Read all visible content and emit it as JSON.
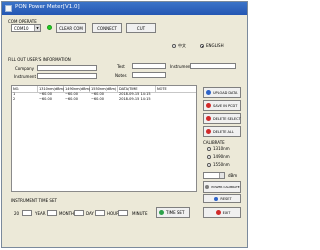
{
  "window": {
    "title": "PON Power Meter[V1.0]"
  },
  "com_operate": {
    "label": "COM OPERATE",
    "port_value": "COM10",
    "clear_com": "CLEAR COM",
    "connect": "CONNECT",
    "cut": "CUT"
  },
  "language": {
    "chinese": "中文",
    "english": "ENGLISH",
    "selected": "english"
  },
  "fill_info": {
    "label": "FILL OUT USER'S INFORMATION",
    "company_label": "Company",
    "company_value": "",
    "test_label": "Test",
    "test_value": "",
    "instrument_label": "Instrument",
    "instrument_value": "",
    "instrument2_label": "Instrument",
    "instrument2_value": "",
    "notes_label": "Notes",
    "notes_value": ""
  },
  "table": {
    "columns": [
      "NO.",
      "1310nm(dBm)",
      "1490nm(dBm)",
      "1550nm(dBm)",
      "DATA/TIME",
      "NOTE"
    ],
    "rows": [
      [
        "1",
        "−60.00",
        "−60.00",
        "−60.00",
        "2018-09-15  14:15",
        ""
      ],
      [
        "2",
        "−60.00",
        "−60.00",
        "−60.00",
        "2018-09-15  14:15",
        ""
      ]
    ]
  },
  "side_buttons": {
    "upload": "UPLOAD DATA",
    "save_pc": "SAVE IN PCDT",
    "delete_select": "DELETE SELECT",
    "delete_all": "DELETE ALL"
  },
  "calibrate": {
    "label": "CALIBRATE",
    "options": [
      "1310nm",
      "1490nm",
      "1550nm"
    ],
    "value": "",
    "unit": "dBm",
    "power_cal": "POWER CALIBRATE",
    "reset": "RESET"
  },
  "time_set": {
    "label": "INSTRUMENT TIME SET",
    "year_value": "20",
    "year_label": "YEAR",
    "month_label": "MONTH",
    "day_label": "DAY",
    "hour_label": "HOUR",
    "minute_label": "MINUTE",
    "time_set_button": "TIME SET",
    "exit_button": "EXIT"
  }
}
